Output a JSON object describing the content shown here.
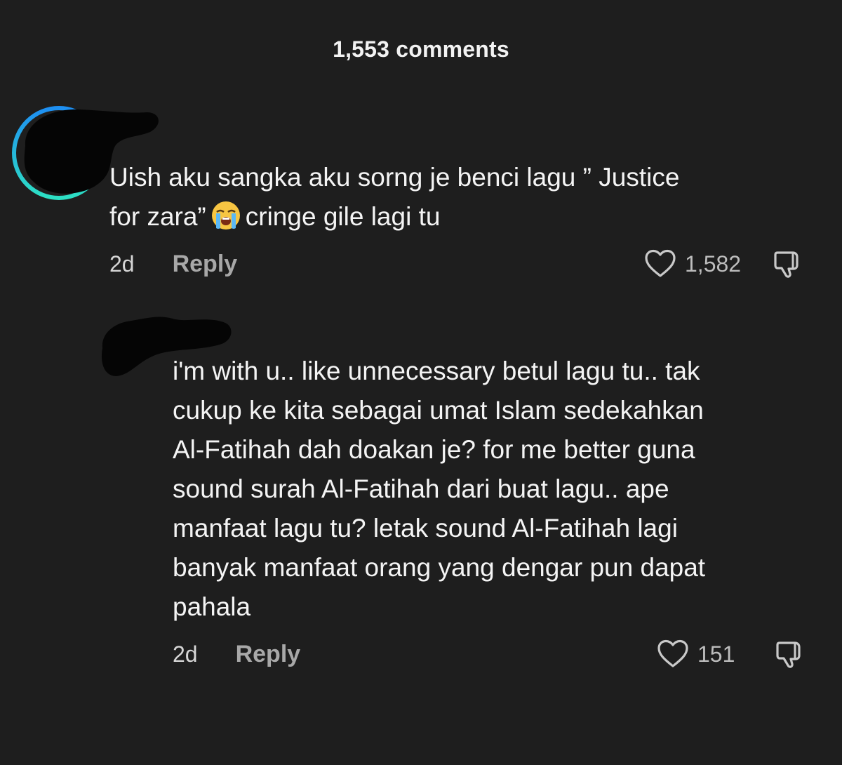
{
  "header": {
    "comment_count_label": "1,553 comments"
  },
  "comments": [
    {
      "avatar_icon": "redacted-avatar",
      "text_line1": "Uish aku sangka aku sorng je benci lagu ” Justice",
      "text_line2_before": "for zara”",
      "emoji": "loudly-crying-face",
      "text_line2_after": "cringe gile lagi tu",
      "time": "2d",
      "reply_label": "Reply",
      "like_count": "1,582",
      "like_icon": "heart-outline-icon",
      "dislike_icon": "thumbs-down-icon"
    },
    {
      "avatar_icon": "redacted-avatar",
      "text_lines": [
        "i'm with u.. like unnecessary betul lagu tu.. tak",
        "cukup ke kita sebagai umat Islam sedekahkan",
        "Al-Fatihah dah doakan je? for me better guna",
        "sound surah Al-Fatihah dari buat lagu.. ape",
        "manfaat lagu tu? letak sound Al-Fatihah lagi",
        "banyak manfaat orang yang dengar pun dapat",
        "pahala"
      ],
      "time": "2d",
      "reply_label": "Reply",
      "like_count": "151",
      "like_icon": "heart-outline-icon",
      "dislike_icon": "thumbs-down-icon"
    }
  ],
  "colors": {
    "background": "#1e1e1e",
    "avatar_ring_start": "#1e8ff2",
    "avatar_ring_end": "#2de0c4",
    "redaction": "#050505"
  }
}
